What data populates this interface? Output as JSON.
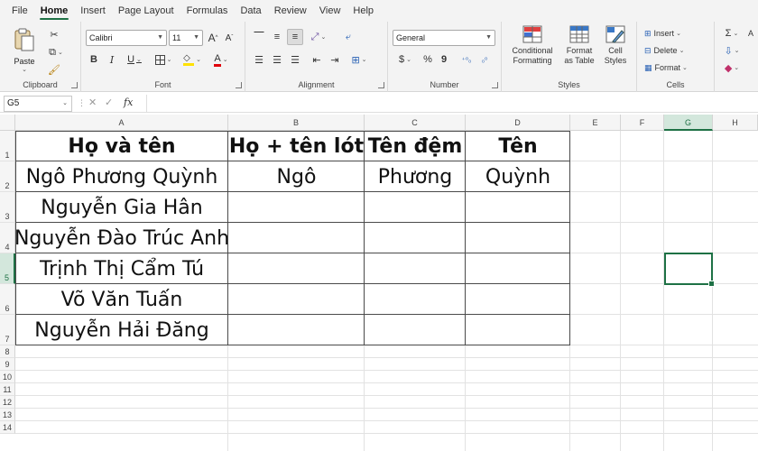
{
  "tabs": [
    "File",
    "Home",
    "Insert",
    "Page Layout",
    "Formulas",
    "Data",
    "Review",
    "View",
    "Help"
  ],
  "active_tab": "Home",
  "ribbon": {
    "clipboard": {
      "paste_label": "Paste",
      "group_label": "Clipboard"
    },
    "font": {
      "font_name": "Calibri",
      "font_size": "11",
      "group_label": "Font",
      "bold": "B",
      "italic": "I",
      "underline": "U",
      "grow": "A",
      "shrink": "A",
      "font_color_letter": "A"
    },
    "alignment": {
      "group_label": "Alignment"
    },
    "number": {
      "format": "General",
      "group_label": "Number",
      "currency": "$",
      "percent": "%",
      "comma": "9"
    },
    "styles": {
      "conditional": "Conditional Formatting",
      "format_table": "Format as Table",
      "cell_styles": "Cell Styles",
      "group_label": "Styles"
    },
    "cells": {
      "insert": "Insert",
      "delete": "Delete",
      "format": "Format",
      "group_label": "Cells"
    }
  },
  "formula_bar": {
    "name_box": "G5",
    "fx": "fx",
    "value": ""
  },
  "columns": [
    "A",
    "B",
    "C",
    "D",
    "E",
    "F",
    "G",
    "H"
  ],
  "selected_column": "G",
  "rows": [
    "1",
    "2",
    "3",
    "4",
    "5",
    "6",
    "7",
    "8",
    "9",
    "10",
    "11",
    "12",
    "13",
    "14"
  ],
  "selected_row": "5",
  "table": {
    "headers": [
      "Họ và tên",
      "Họ + tên lót",
      "Tên đệm",
      "Tên"
    ],
    "rows": [
      [
        "Ngô Phương Quỳnh",
        "Ngô",
        "Phương",
        "Quỳnh"
      ],
      [
        "Nguyễn Gia Hân",
        "",
        "",
        ""
      ],
      [
        "Nguyễn Đào Trúc Anh",
        "",
        "",
        ""
      ],
      [
        "Trịnh Thị Cẩm Tú",
        "",
        "",
        ""
      ],
      [
        "Võ Văn Tuấn",
        "",
        "",
        ""
      ],
      [
        "Nguyễn Hải Đăng",
        "",
        "",
        ""
      ]
    ]
  },
  "colors": {
    "accent": "#1e7145",
    "border": "#4a4a4a"
  }
}
